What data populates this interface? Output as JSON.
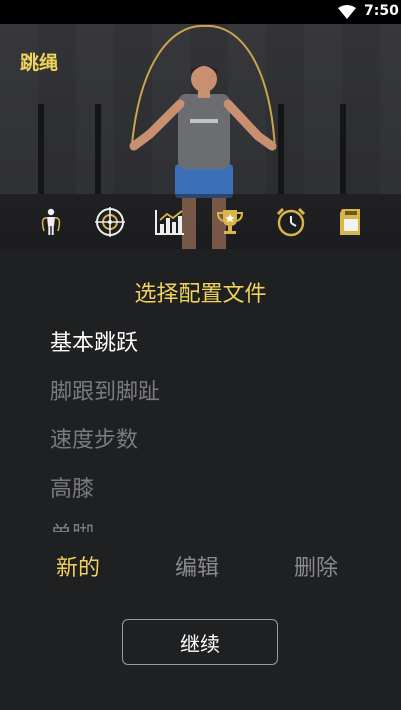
{
  "status_bar": {
    "time": "7:50",
    "wifi_icon": "wifi-icon"
  },
  "app": {
    "title": "跳绳",
    "accent": "#f0d35a"
  },
  "toolbar": {
    "icons": [
      "person-icon",
      "crosshair-icon",
      "bar-chart-icon",
      "trophy-icon",
      "alarm-clock-icon",
      "sd-card-icon"
    ]
  },
  "profiles": {
    "title": "选择配置文件",
    "items": [
      "基本跳跃",
      "脚跟到脚趾",
      "速度步数",
      "高膝",
      "单脚"
    ],
    "selected": "基本跳跃"
  },
  "actions": {
    "new": "新的",
    "edit": "编辑",
    "delete": "删除"
  },
  "continue_label": "继续"
}
